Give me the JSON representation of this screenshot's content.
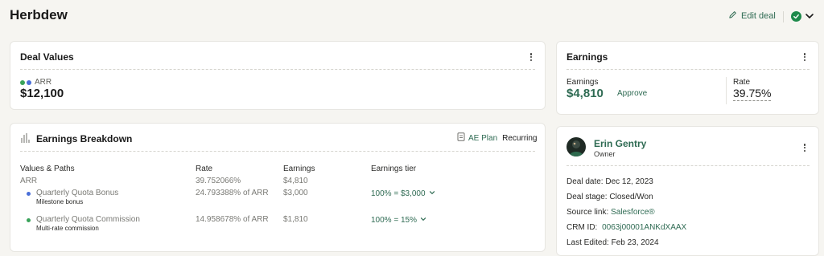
{
  "header": {
    "title": "Herbdew",
    "edit_label": "Edit deal"
  },
  "deal_values": {
    "title": "Deal Values",
    "metric_label": "ARR",
    "metric_value": "$12,100",
    "dot_colors": [
      "#3aa35a",
      "#4a6fd8"
    ]
  },
  "breakdown": {
    "title": "Earnings Breakdown",
    "plan_label": "AE Plan",
    "plan_type": "Recurring",
    "columns": [
      "Values & Paths",
      "Rate",
      "Earnings",
      "Earnings tier"
    ],
    "total": {
      "path": "ARR",
      "rate": "39.752066%",
      "earnings": "$4,810"
    },
    "rows": [
      {
        "path": "Quarterly Quota Bonus",
        "sub": "Milestone bonus",
        "rate": "24.793388% of ARR",
        "earnings": "$3,000",
        "tier": "100% = $3,000",
        "dot": "#4a6fd8"
      },
      {
        "path": "Quarterly Quota Commission",
        "sub": "Multi-rate commission",
        "rate": "14.958678% of ARR",
        "earnings": "$1,810",
        "tier": "100% = 15%",
        "dot": "#3aa35a"
      }
    ]
  },
  "earnings": {
    "title": "Earnings",
    "earnings_label": "Earnings",
    "earnings_value": "$4,810",
    "approve_label": "Approve",
    "rate_label": "Rate",
    "rate_value": "39.75%"
  },
  "owner": {
    "name": "Erin Gentry",
    "role": "Owner",
    "deal_date_label": "Deal date:",
    "deal_date": "Dec 12, 2023",
    "deal_stage_label": "Deal stage:",
    "deal_stage": "Closed/Won",
    "source_label": "Source link:",
    "source_value": "Salesforce®",
    "crm_label": "CRM ID:",
    "crm_value": "0063j00001ANKdXAAX",
    "edited_label": "Last Edited:",
    "edited_value": "Feb 23, 2024"
  },
  "colors": {
    "accent_green": "#2f6b53",
    "status_green": "#1e8a4c",
    "background": "#f6f5f1"
  },
  "icons": [
    "pencil-icon",
    "check-circle-icon",
    "chevron-down-icon",
    "kebab-icon",
    "chart-bars-icon",
    "document-icon",
    "avatar"
  ]
}
